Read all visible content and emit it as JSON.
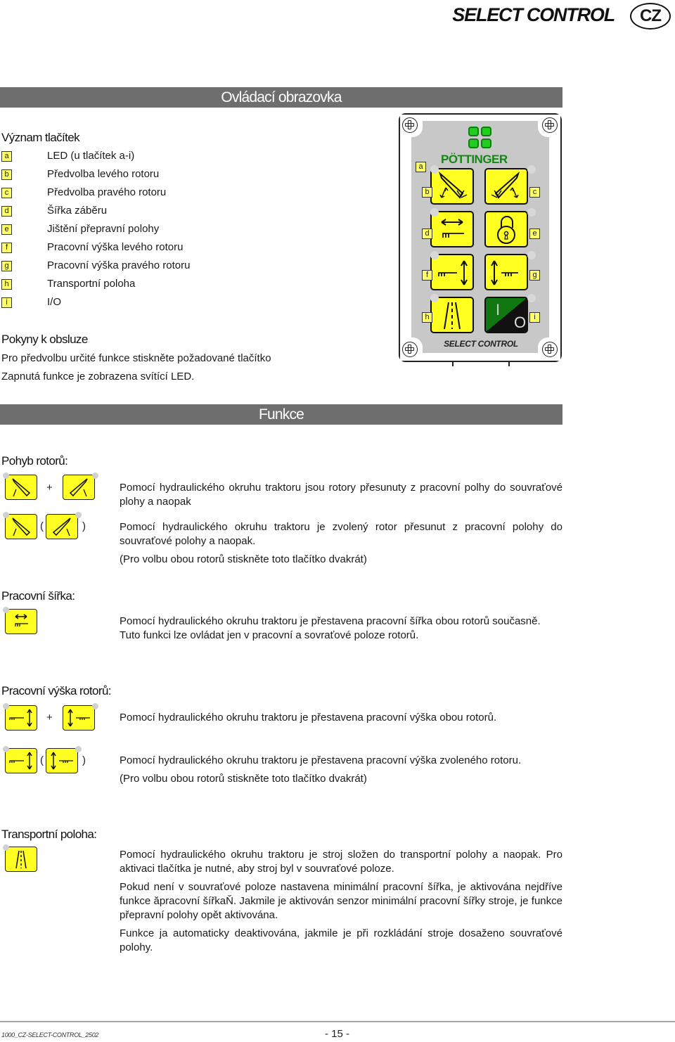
{
  "header": {
    "title": "SELECT CONTROL",
    "language_badge": "CZ"
  },
  "section_bars": {
    "screen": "Ovládací obrazovka",
    "functions": "Funkce"
  },
  "legend": {
    "heading": "Význam tlačítek",
    "items": [
      {
        "key": "a",
        "label": "LED (u tlačítek a-i)"
      },
      {
        "key": "b",
        "label": "Předvolba levého rotoru"
      },
      {
        "key": "c",
        "label": "Předvolba pravého rotoru"
      },
      {
        "key": "d",
        "label": "Šířka záběru"
      },
      {
        "key": "e",
        "label": "Jištění přepravní polohy"
      },
      {
        "key": "f",
        "label": "Pracovní výška levého rotoru"
      },
      {
        "key": "g",
        "label": "Pracovní výška pravého rotoru"
      },
      {
        "key": "h",
        "label": "Transportní poloha"
      },
      {
        "key": "i",
        "label": "I/O"
      }
    ]
  },
  "instructions": {
    "heading": "Pokyny k obsluze",
    "lines": [
      "Pro předvolbu určité funkce stiskněte požadované tlačítko",
      "Zapnutá funkce je zobrazena svítící LED."
    ]
  },
  "panel": {
    "brand": "PÖTTINGER",
    "name": "SELECT CONTROL",
    "on_label": "I",
    "off_label": "O",
    "labels": [
      "a",
      "b",
      "c",
      "d",
      "e",
      "f",
      "g",
      "h",
      "i"
    ],
    "colors": {
      "button": "#ffff22",
      "logo": "#22cc22",
      "brand": "#118811",
      "panel": "#c8c8c8"
    }
  },
  "functions": {
    "rotor_movement": {
      "heading": "Pohyb rotorů:",
      "plus": "+",
      "open_paren": "(",
      "close_paren": ")",
      "desc1": "Pomocí hydraulického okruhu traktoru jsou rotory přesunuty z pracovní polhy do souvraťové plohy a naopak",
      "desc2": "Pomocí hydraulického okruhu traktoru je zvolený rotor přesunut z pracovní polohy do souvraťové polohy a naopak.",
      "desc3": "(Pro volbu obou rotorů stiskněte toto tlačítko dvakrát)"
    },
    "working_width": {
      "heading": "Pracovní šířka:",
      "desc": "Pomocí hydraulického okruhu traktoru je přestavena pracovní šířka obou rotorů současně. Tuto funkci lze ovládat jen v pracovní a sovraťové poloze rotorů."
    },
    "working_height": {
      "heading": "Pracovní výška rotorů:",
      "plus": "+",
      "open_paren": "(",
      "close_paren": ")",
      "desc1": "Pomocí hydraulického okruhu traktoru je přestavena pracovní výška obou rotorů.",
      "desc2": "Pomocí hydraulického okruhu traktoru je přestavena pracovní výška zvoleného rotoru.",
      "desc3": "(Pro volbu obou rotorů stiskněte toto tlačítko dvakrát)"
    },
    "transport": {
      "heading": "Transportní poloha:",
      "desc1": "Pomocí hydraulického okruhu traktoru je stroj složen do transportní polohy a naopak. Pro aktivaci tlačítka je nutné, aby stroj byl v souvraťové poloze.",
      "desc2": "Pokud není v souvraťové poloze nastavena minimální pracovní šířka, je aktivována nejdříve funkce ăpracovní šířkaŇ. Jakmile je aktivován senzor minimální pracovní šířky stroje, je funkce přepravní polohy opět aktivována.",
      "desc3": "Funkce ja automaticky deaktivována, jakmile je při rozkládání stroje dosaženo souvraťové polohy."
    }
  },
  "footer": {
    "doc_code": "1000_CZ-SELECT-CONTROL_2502",
    "page": "- 15 -"
  }
}
